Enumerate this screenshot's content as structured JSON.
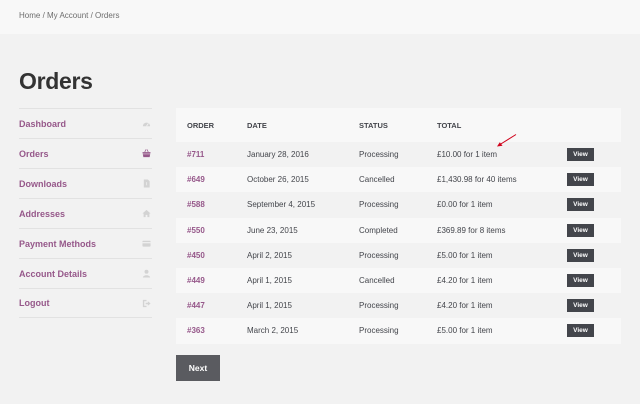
{
  "breadcrumb": {
    "text": "Home / My Account / Orders"
  },
  "page": {
    "title": "Orders"
  },
  "sidebar": {
    "items": [
      {
        "label": "Dashboard",
        "icon": "dashboard-icon"
      },
      {
        "label": "Orders",
        "icon": "basket-icon"
      },
      {
        "label": "Downloads",
        "icon": "file-icon"
      },
      {
        "label": "Addresses",
        "icon": "home-icon"
      },
      {
        "label": "Payment Methods",
        "icon": "credit-card-icon"
      },
      {
        "label": "Account Details",
        "icon": "user-icon"
      },
      {
        "label": "Logout",
        "icon": "logout-icon"
      }
    ]
  },
  "orders": {
    "headers": [
      "ORDER",
      "DATE",
      "STATUS",
      "TOTAL",
      ""
    ],
    "rows": [
      {
        "order": "#711",
        "date": "January 28, 2016",
        "status": "Processing",
        "total": "£10.00 for 1 item",
        "action": "View"
      },
      {
        "order": "#649",
        "date": "October 26, 2015",
        "status": "Cancelled",
        "total": "£1,430.98 for 40 items",
        "action": "View"
      },
      {
        "order": "#588",
        "date": "September 4, 2015",
        "status": "Processing",
        "total": "£0.00 for 1 item",
        "action": "View"
      },
      {
        "order": "#550",
        "date": "June 23, 2015",
        "status": "Completed",
        "total": "£369.89 for 8 items",
        "action": "View"
      },
      {
        "order": "#450",
        "date": "April 2, 2015",
        "status": "Processing",
        "total": "£5.00 for 1 item",
        "action": "View"
      },
      {
        "order": "#449",
        "date": "April 1, 2015",
        "status": "Cancelled",
        "total": "£4.20 for 1 item",
        "action": "View"
      },
      {
        "order": "#447",
        "date": "April 1, 2015",
        "status": "Processing",
        "total": "£4.20 for 1 item",
        "action": "View"
      },
      {
        "order": "#363",
        "date": "March 2, 2015",
        "status": "Processing",
        "total": "£5.00 for 1 item",
        "action": "View"
      }
    ]
  },
  "pagination": {
    "next_label": "Next"
  },
  "colors": {
    "accent": "#96588a",
    "button": "#43454b",
    "annotation": "#d0021b"
  }
}
